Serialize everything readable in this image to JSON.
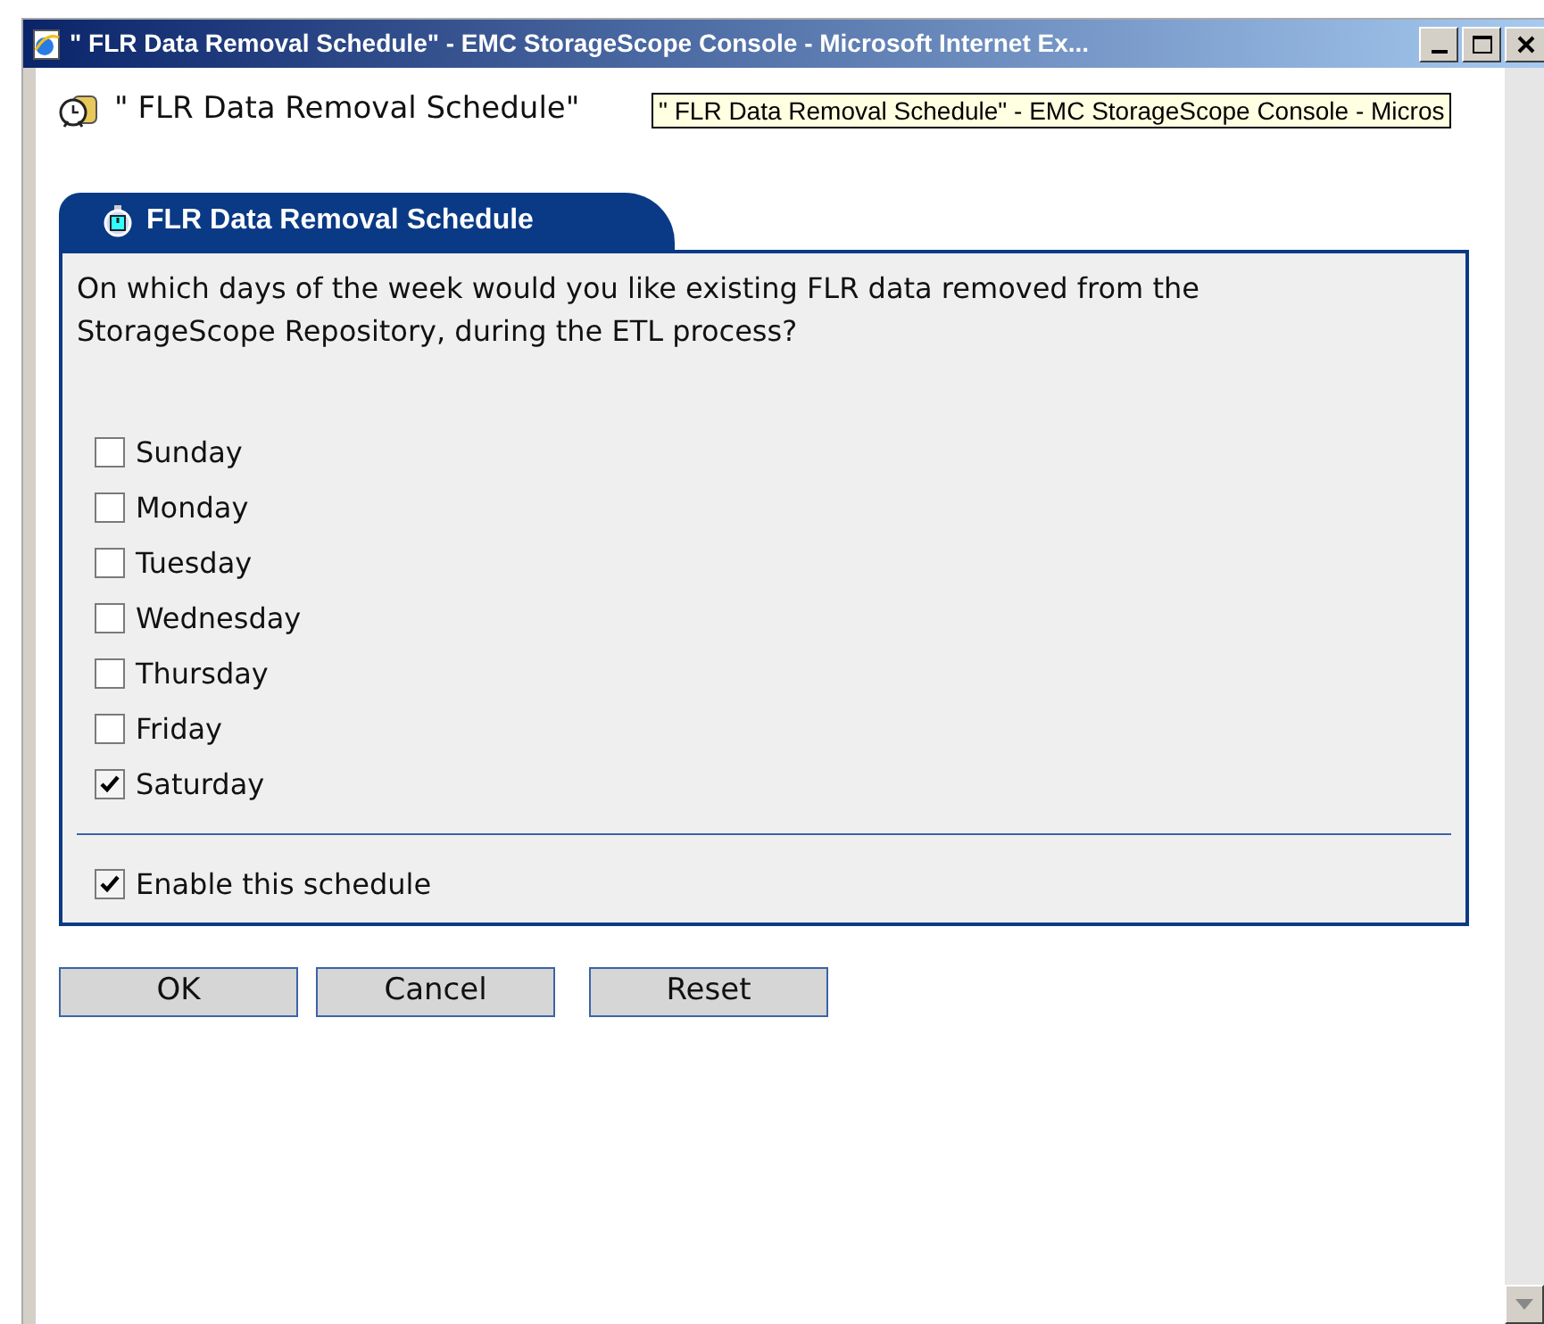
{
  "window": {
    "title": "\" FLR Data Removal Schedule\" - EMC StorageScope Console - Microsoft Internet Ex..."
  },
  "header": {
    "title": "\" FLR Data Removal Schedule\""
  },
  "tooltip": {
    "text": "\" FLR Data Removal Schedule\" - EMC StorageScope Console - Micros"
  },
  "tab": {
    "label": "FLR Data Removal Schedule"
  },
  "question": "On which days of the week would you like existing FLR data removed from the StorageScope Repository, during the ETL process?",
  "days": [
    {
      "label": "Sunday",
      "checked": false
    },
    {
      "label": "Monday",
      "checked": false
    },
    {
      "label": "Tuesday",
      "checked": false
    },
    {
      "label": "Wednesday",
      "checked": false
    },
    {
      "label": "Thursday",
      "checked": false
    },
    {
      "label": "Friday",
      "checked": false
    },
    {
      "label": "Saturday",
      "checked": true
    }
  ],
  "enable": {
    "label": "Enable this schedule",
    "checked": true
  },
  "buttons": [
    "OK",
    "Cancel",
    "Reset"
  ]
}
